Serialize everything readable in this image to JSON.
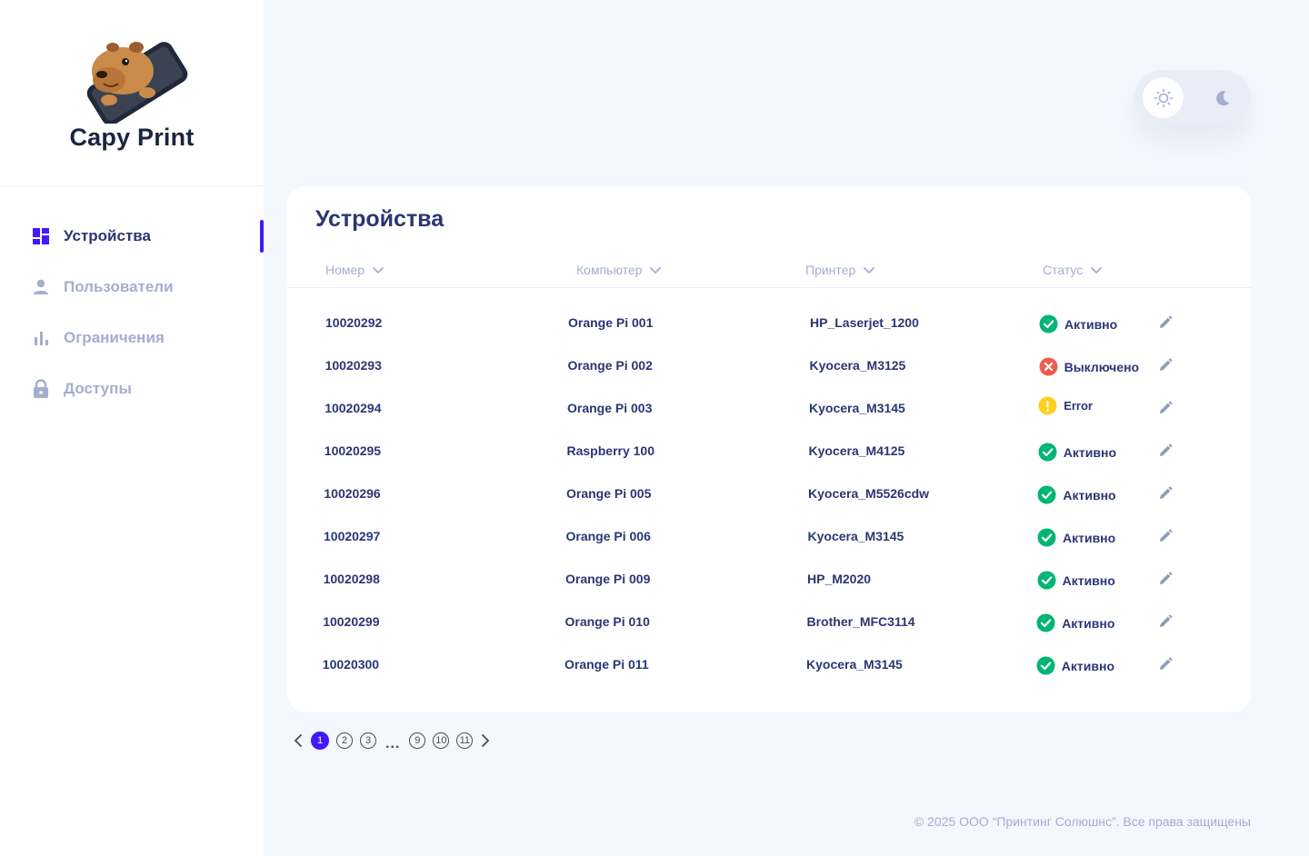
{
  "brand": {
    "name": "Capy Print"
  },
  "sidebar": {
    "items": [
      {
        "label": "Устройства",
        "icon": "dashboard-icon",
        "active": true
      },
      {
        "label": "Пользователи",
        "icon": "user-icon",
        "active": false
      },
      {
        "label": "Ограничения",
        "icon": "bar-chart-icon",
        "active": false
      },
      {
        "label": "Доступы",
        "icon": "lock-icon",
        "active": false
      }
    ]
  },
  "theme_toggle": {
    "light_icon": "sun-icon",
    "dark_icon": "moon-icon",
    "selected": "light"
  },
  "devices": {
    "title": "Устройства",
    "columns": [
      {
        "label": "Номер"
      },
      {
        "label": "Компьютер"
      },
      {
        "label": "Принтер"
      },
      {
        "label": "Статус"
      }
    ],
    "rows": [
      {
        "number": "10020292",
        "computer": "Orange Pi 001",
        "printer": "HP_Laserjet_1200",
        "status": "Активно",
        "status_type": "ok"
      },
      {
        "number": "10020293",
        "computer": "Orange Pi 002",
        "printer": "Kyocera_M3125",
        "status": "Выключено",
        "status_type": "off"
      },
      {
        "number": "10020294",
        "computer": "Orange Pi 003",
        "printer": "Kyocera_M3145",
        "status": "Error",
        "status_type": "error"
      },
      {
        "number": "10020295",
        "computer": "Raspberry 100",
        "printer": "Kyocera_M4125",
        "status": "Активно",
        "status_type": "ok"
      },
      {
        "number": "10020296",
        "computer": "Orange Pi 005",
        "printer": "Kyocera_M5526cdw",
        "status": "Активно",
        "status_type": "ok"
      },
      {
        "number": "10020297",
        "computer": "Orange Pi 006",
        "printer": "Kyocera_M3145",
        "status": "Активно",
        "status_type": "ok"
      },
      {
        "number": "10020298",
        "computer": "Orange Pi 009",
        "printer": "HP_M2020",
        "status": "Активно",
        "status_type": "ok"
      },
      {
        "number": "10020299",
        "computer": "Orange Pi 010",
        "printer": "Brother_MFC3114",
        "status": "Активно",
        "status_type": "ok"
      },
      {
        "number": "10020300",
        "computer": "Orange Pi 011",
        "printer": "Kyocera_M3145",
        "status": "Активно",
        "status_type": "ok"
      }
    ]
  },
  "pagination": {
    "current": "1",
    "pages_start": [
      "1",
      "2",
      "3"
    ],
    "ellipsis": "...",
    "pages_end": [
      "9",
      "10",
      "11"
    ]
  },
  "footer": {
    "copyright": "© 2025 ООО “Принтинг Солюшнс”. Все права защищены"
  },
  "colors": {
    "accent": "#4318ff",
    "text_primary": "#2b3674",
    "text_muted": "#a3aed0",
    "status_ok": "#01b574",
    "status_off": "#ee5d50",
    "status_error": "#ffce20",
    "background": "#f4f7fe"
  }
}
